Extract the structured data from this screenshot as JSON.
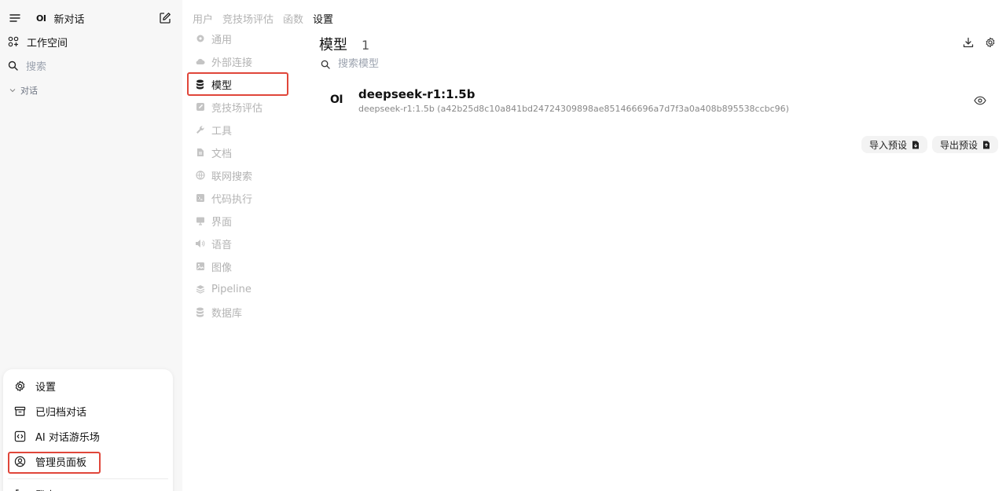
{
  "sidebar": {
    "logo": "OI",
    "new_chat_label": "新对话",
    "workspace_label": "工作空间",
    "search_label": "搜索",
    "chats_section_label": "对话"
  },
  "user_menu": {
    "items": [
      {
        "label": "设置",
        "icon": "gear-icon"
      },
      {
        "label": "已归档对话",
        "icon": "archive-icon"
      },
      {
        "label": "AI 对话游乐场",
        "icon": "code-icon"
      },
      {
        "label": "管理员面板",
        "icon": "user-circle-icon"
      },
      {
        "label": "登出",
        "icon": "logout-icon"
      }
    ]
  },
  "top_tabs": [
    {
      "label": "用户"
    },
    {
      "label": "竞技场评估"
    },
    {
      "label": "函数"
    },
    {
      "label": "设置"
    }
  ],
  "settings_nav": [
    {
      "label": "通用",
      "icon": "gear-icon"
    },
    {
      "label": "外部连接",
      "icon": "cloud-icon"
    },
    {
      "label": "模型",
      "icon": "database-icon"
    },
    {
      "label": "竞技场评估",
      "icon": "pencil-icon"
    },
    {
      "label": "工具",
      "icon": "wrench-icon"
    },
    {
      "label": "文档",
      "icon": "document-icon"
    },
    {
      "label": "联网搜索",
      "icon": "globe-icon"
    },
    {
      "label": "代码执行",
      "icon": "terminal-icon"
    },
    {
      "label": "界面",
      "icon": "monitor-icon"
    },
    {
      "label": "语音",
      "icon": "speaker-icon"
    },
    {
      "label": "图像",
      "icon": "image-icon"
    },
    {
      "label": "Pipeline",
      "icon": "layers-icon"
    },
    {
      "label": "数据库",
      "icon": "database-icon"
    }
  ],
  "main": {
    "title": "模型",
    "count": "1",
    "search_placeholder": "搜索模型",
    "models": [
      {
        "logo": "OI",
        "name": "deepseek-r1:1.5b",
        "detail": "deepseek-r1:1.5b (a42b25d8c10a841bd24724309898ae851466696a7d7f3a0a408b895538ccbc96)"
      }
    ],
    "import_label": "导入预设",
    "export_label": "导出预设"
  },
  "colors": {
    "highlight": "#e0463a",
    "sidebar_bg": "#f7f7f7",
    "muted_text": "#b3b3b3"
  }
}
